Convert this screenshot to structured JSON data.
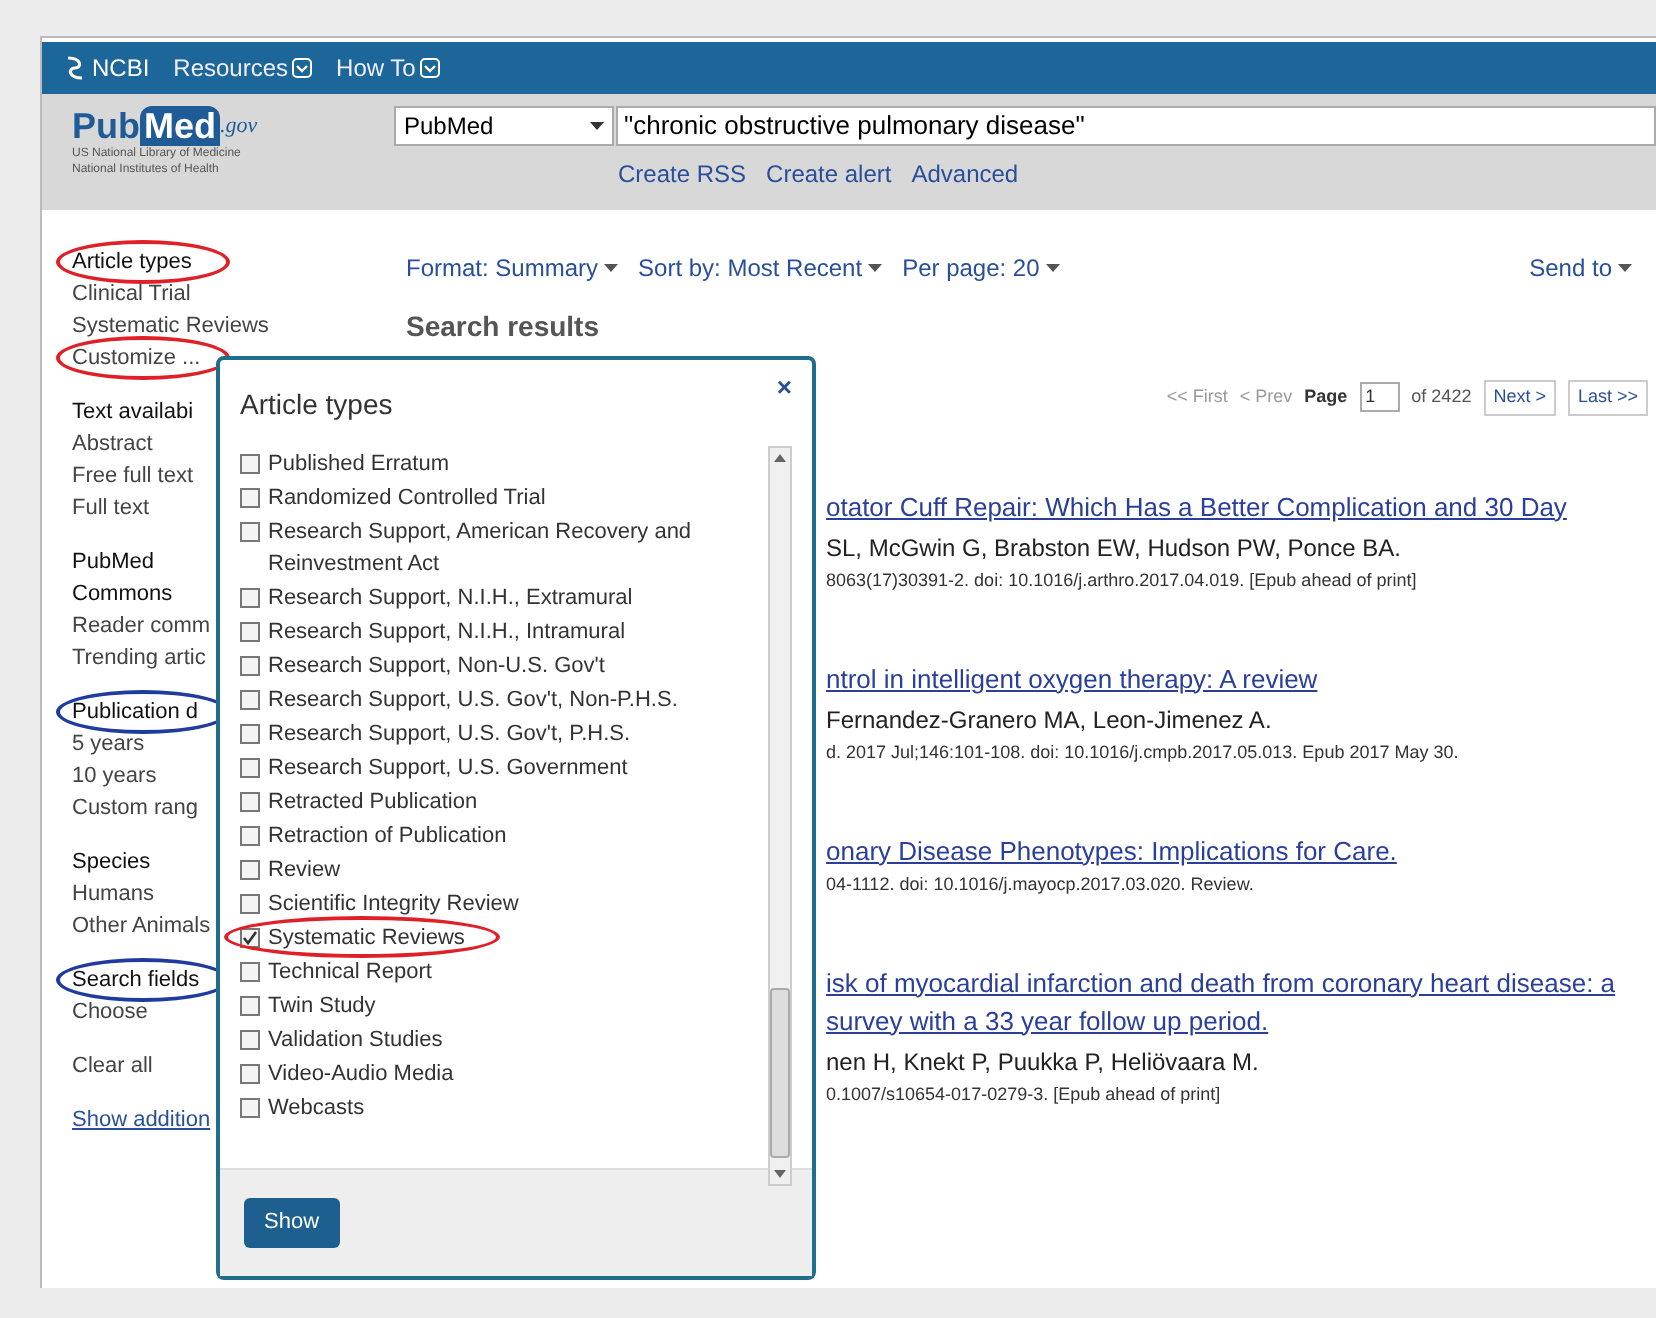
{
  "topbar": {
    "brand": "NCBI",
    "menus": [
      "Resources",
      "How To"
    ]
  },
  "masthead": {
    "logo": {
      "pub": "Pub",
      "med": "Med",
      "gov": ".gov"
    },
    "logo_caption": [
      "US National Library of Medicine",
      "National Institutes of Health"
    ],
    "database": "PubMed",
    "query": "\"chronic obstructive pulmonary disease\"",
    "links": [
      "Create RSS",
      "Create alert",
      "Advanced"
    ]
  },
  "sidebar": [
    {
      "items": [
        {
          "label": "Article types",
          "kind": "heading",
          "circle": {
            "color": "#e02027"
          }
        },
        {
          "label": "Clinical Trial",
          "kind": "link"
        },
        {
          "label": "Systematic Reviews",
          "kind": "link"
        },
        {
          "label": "Customize ...",
          "kind": "link",
          "circle": {
            "color": "#e02027"
          }
        }
      ]
    },
    {
      "items": [
        {
          "label": "Text availabi",
          "kind": "heading"
        },
        {
          "label": "Abstract",
          "kind": "link"
        },
        {
          "label": "Free full text",
          "kind": "link"
        },
        {
          "label": "Full text",
          "kind": "link"
        }
      ]
    },
    {
      "items": [
        {
          "label": "PubMed",
          "kind": "heading"
        },
        {
          "label": "Commons",
          "kind": "heading"
        },
        {
          "label": "Reader comm",
          "kind": "link"
        },
        {
          "label": "Trending artic",
          "kind": "link"
        }
      ]
    },
    {
      "items": [
        {
          "label": "Publication d",
          "kind": "heading",
          "circle": {
            "color": "#1f3b9e"
          }
        },
        {
          "label": "5 years",
          "kind": "link"
        },
        {
          "label": "10 years",
          "kind": "link"
        },
        {
          "label": "Custom rang",
          "kind": "link"
        }
      ]
    },
    {
      "items": [
        {
          "label": "Species",
          "kind": "heading"
        },
        {
          "label": "Humans",
          "kind": "link"
        },
        {
          "label": "Other Animals",
          "kind": "link"
        }
      ]
    },
    {
      "items": [
        {
          "label": "Search fields",
          "kind": "heading",
          "circle": {
            "color": "#1f3b9e"
          }
        },
        {
          "label": "Choose",
          "kind": "link"
        }
      ]
    },
    {
      "items": [
        {
          "label": "Clear all",
          "kind": "link"
        }
      ]
    },
    {
      "items": [
        {
          "label": "Show addition",
          "kind": "underlined"
        }
      ]
    }
  ],
  "toolbar": {
    "options": [
      "Format: Summary",
      "Sort by: Most Recent",
      "Per page: 20"
    ],
    "send_to": "Send to"
  },
  "heading": "Search results",
  "pager": {
    "first": "<< First",
    "prev": "< Prev",
    "page_label": "Page",
    "page": "1",
    "of": "of 2422",
    "next": "Next >",
    "last": "Last >>"
  },
  "results": [
    {
      "lines": [
        {
          "kind": "title",
          "text": "otator Cuff Repair: Which Has a Better Complication and 30 Day"
        },
        {
          "kind": "authors",
          "text": "SL, McGwin G, Brabston EW, Hudson PW, Ponce BA."
        },
        {
          "kind": "citation",
          "text": "8063(17)30391-2. doi: 10.1016/j.arthro.2017.04.019. [Epub ahead of print]"
        }
      ]
    },
    {
      "lines": [
        {
          "kind": "title",
          "text": "ntrol in intelligent oxygen therapy: A review"
        },
        {
          "kind": "authors",
          "text": "Fernandez-Granero MA, Leon-Jimenez A."
        },
        {
          "kind": "citation",
          "text": "d. 2017 Jul;146:101-108. doi: 10.1016/j.cmpb.2017.05.013. Epub 2017 May 30."
        }
      ]
    },
    {
      "lines": [
        {
          "kind": "title",
          "text": "onary Disease Phenotypes: Implications for Care."
        },
        {
          "kind": "citation",
          "text": "04-1112. doi: 10.1016/j.mayocp.2017.03.020. Review."
        }
      ]
    },
    {
      "lines": [
        {
          "kind": "title",
          "text": "isk of myocardial infarction and death from coronary heart disease: a"
        },
        {
          "kind": "title",
          "text": "survey with a 33 year follow up period."
        },
        {
          "kind": "authors",
          "text": "nen H, Knekt P, Puukka P, Heliövaara M."
        },
        {
          "kind": "citation",
          "text": "0.1007/s10654-017-0279-3. [Epub ahead of print]"
        }
      ]
    }
  ],
  "dialog": {
    "title": "Article types",
    "close": "×",
    "button": "Show",
    "options": [
      {
        "label": "Published Erratum",
        "checked": false
      },
      {
        "label": "Randomized Controlled Trial",
        "checked": false
      },
      {
        "label": "Research Support, American Recovery and Reinvestment Act",
        "checked": false
      },
      {
        "label": "Research Support, N.I.H., Extramural",
        "checked": false
      },
      {
        "label": "Research Support, N.I.H., Intramural",
        "checked": false
      },
      {
        "label": "Research Support, Non-U.S. Gov't",
        "checked": false
      },
      {
        "label": "Research Support, U.S. Gov't, Non-P.H.S.",
        "checked": false
      },
      {
        "label": "Research Support, U.S. Gov't, P.H.S.",
        "checked": false
      },
      {
        "label": "Research Support, U.S. Government",
        "checked": false
      },
      {
        "label": "Retracted Publication",
        "checked": false
      },
      {
        "label": "Retraction of Publication",
        "checked": false
      },
      {
        "label": "Review",
        "checked": false
      },
      {
        "label": "Scientific Integrity Review",
        "checked": false
      },
      {
        "label": "Systematic Reviews",
        "checked": true,
        "circle": {
          "color": "#e02027"
        }
      },
      {
        "label": "Technical Report",
        "checked": false
      },
      {
        "label": "Twin Study",
        "checked": false
      },
      {
        "label": "Validation Studies",
        "checked": false
      },
      {
        "label": "Video-Audio Media",
        "checked": false
      },
      {
        "label": "Webcasts",
        "checked": false
      }
    ]
  }
}
